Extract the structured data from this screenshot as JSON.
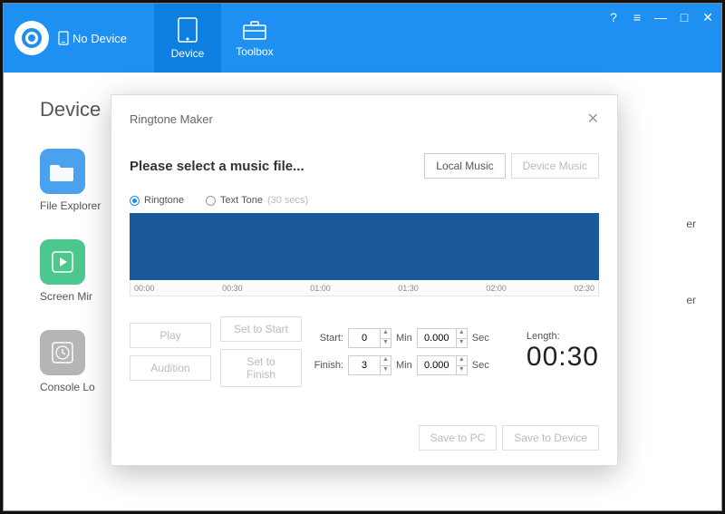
{
  "header": {
    "device_status": "No Device",
    "tabs": {
      "device": "Device",
      "toolbox": "Toolbox"
    }
  },
  "page": {
    "title_fragment": "Device"
  },
  "sidebar": {
    "items": [
      {
        "label": "File Explorer"
      },
      {
        "label": "Screen Mir"
      },
      {
        "label": "Console Lo"
      }
    ],
    "right_fragments": [
      "er",
      "er"
    ]
  },
  "modal": {
    "title": "Ringtone Maker",
    "instruction": "Please select a music file...",
    "buttons": {
      "local_music": "Local Music",
      "device_music": "Device Music",
      "play": "Play",
      "audition": "Audition",
      "set_to_start": "Set to Start",
      "set_to_finish": "Set to Finish",
      "save_to_pc": "Save to PC",
      "save_to_device": "Save to Device"
    },
    "tone_type": {
      "ringtone": "Ringtone",
      "text_tone": "Text Tone",
      "text_tone_hint": "(30 secs)",
      "selected": "ringtone"
    },
    "timeline": [
      "00:00",
      "00:30",
      "01:00",
      "01:30",
      "02:00",
      "02:30"
    ],
    "fields": {
      "start_label": "Start:",
      "finish_label": "Finish:",
      "min_label": "Min",
      "sec_label": "Sec",
      "start_min": "0",
      "start_sec": "0.000",
      "finish_min": "3",
      "finish_sec": "0.000"
    },
    "length": {
      "label": "Length:",
      "value": "00:30"
    }
  }
}
